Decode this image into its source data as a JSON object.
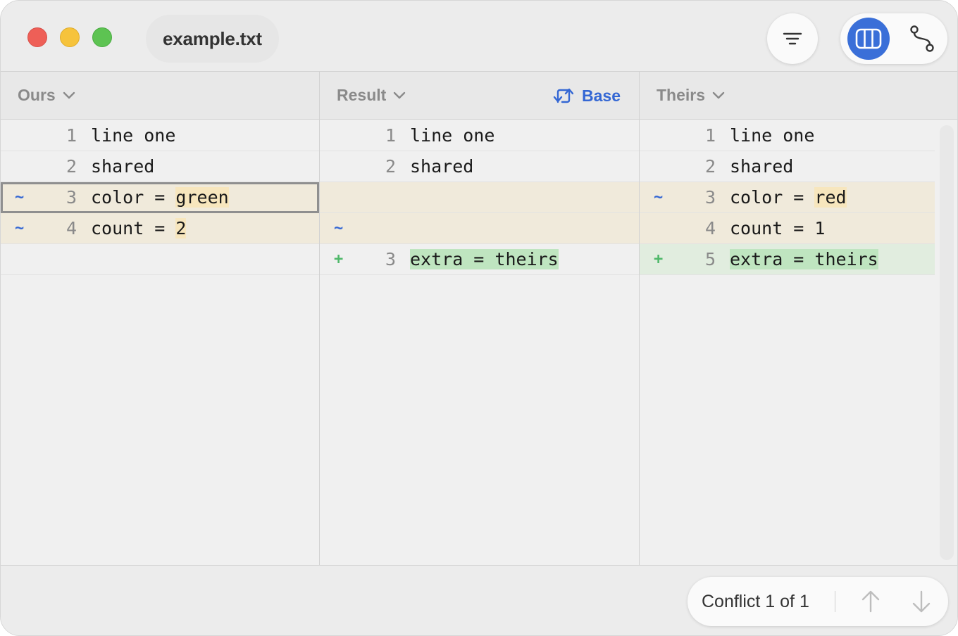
{
  "window": {
    "file_name": "example.txt",
    "buttons": {
      "filter_icon": "filter-lines-icon",
      "columns_view_icon": "three-column-icon",
      "graph_view_icon": "branch-graph-icon"
    }
  },
  "panes": {
    "ours": {
      "title": "Ours",
      "rows": [
        {
          "marker": "",
          "lineno": "1",
          "text": "line one",
          "highlight": ""
        },
        {
          "marker": "",
          "lineno": "2",
          "text": "shared",
          "highlight": ""
        },
        {
          "marker": "~",
          "lineno": "3",
          "text": "color = ",
          "highlight": "green"
        },
        {
          "marker": "~",
          "lineno": "4",
          "text": "count = ",
          "highlight": "2"
        },
        {
          "marker": "",
          "lineno": "",
          "text": "",
          "highlight": ""
        }
      ]
    },
    "result": {
      "title": "Result",
      "base_label": "Base",
      "rows": [
        {
          "marker": "",
          "lineno": "1",
          "text": "line one",
          "highlight": ""
        },
        {
          "marker": "",
          "lineno": "2",
          "text": "shared",
          "highlight": ""
        },
        {
          "marker": "",
          "lineno": "",
          "text": "",
          "highlight": ""
        },
        {
          "marker": "~",
          "lineno": "",
          "text": "",
          "highlight": ""
        },
        {
          "marker": "+",
          "lineno": "3",
          "text": "",
          "highlight": "extra = theirs"
        }
      ]
    },
    "theirs": {
      "title": "Theirs",
      "rows": [
        {
          "marker": "",
          "lineno": "1",
          "text": "line one",
          "highlight": ""
        },
        {
          "marker": "",
          "lineno": "2",
          "text": "shared",
          "highlight": ""
        },
        {
          "marker": "~",
          "lineno": "3",
          "text": "color = ",
          "highlight": "red"
        },
        {
          "marker": "",
          "lineno": "4",
          "text": "count = 1",
          "highlight": ""
        },
        {
          "marker": "+",
          "lineno": "5",
          "text": "",
          "highlight": "extra = theirs"
        }
      ]
    }
  },
  "footer": {
    "conflict_label": "Conflict 1 of 1"
  },
  "colors": {
    "accent": "#3a6fd8",
    "modified_bg": "#f0eadb",
    "added_bg": "#e1eddf",
    "word_changed": "#f7e6bd",
    "word_added": "#bfe5c0"
  }
}
